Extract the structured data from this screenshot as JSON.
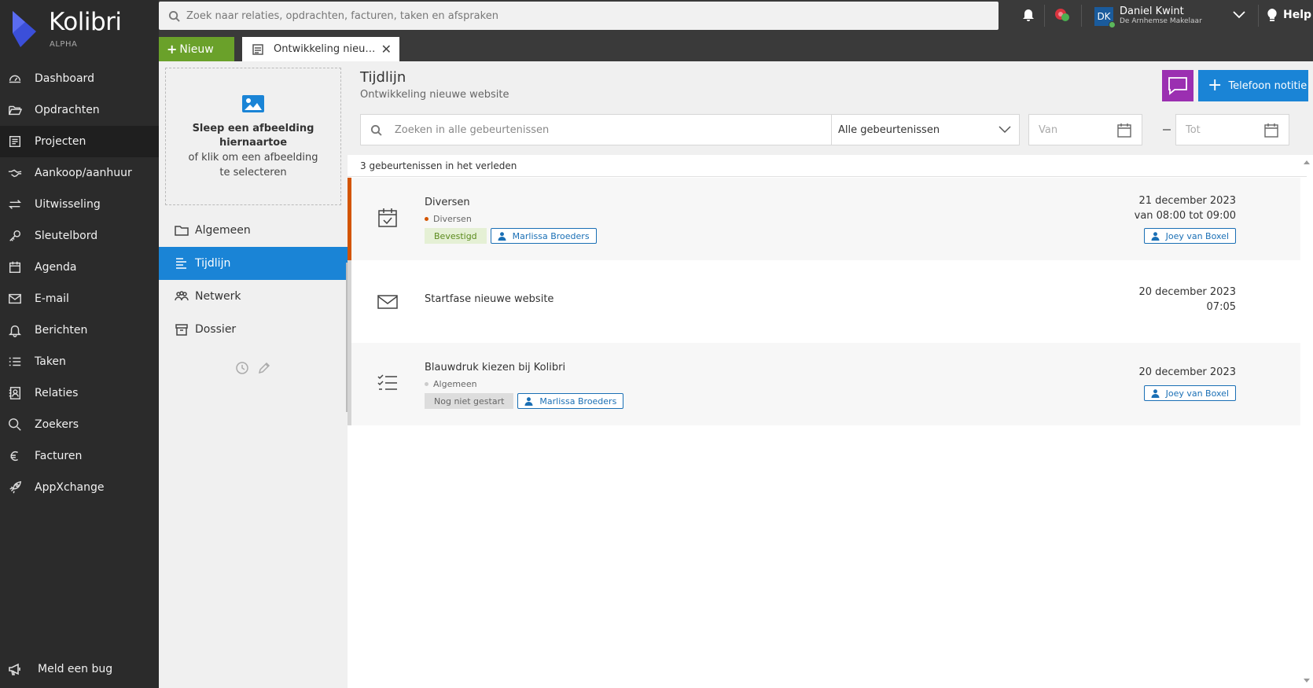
{
  "app": {
    "name": "Kolibri",
    "edition": "ALPHA"
  },
  "sidebar": {
    "items": [
      {
        "label": "Dashboard",
        "icon": "dashboard-icon"
      },
      {
        "label": "Opdrachten",
        "icon": "folder-open-icon"
      },
      {
        "label": "Projecten",
        "icon": "projects-icon"
      },
      {
        "label": "Aankoop/aanhuur",
        "icon": "handshake-icon"
      },
      {
        "label": "Uitwisseling",
        "icon": "exchange-icon"
      },
      {
        "label": "Sleutelbord",
        "icon": "key-icon"
      },
      {
        "label": "Agenda",
        "icon": "calendar-icon"
      },
      {
        "label": "E-mail",
        "icon": "envelope-icon"
      },
      {
        "label": "Berichten",
        "icon": "bell-icon"
      },
      {
        "label": "Taken",
        "icon": "tasks-icon"
      },
      {
        "label": "Relaties",
        "icon": "contacts-icon"
      },
      {
        "label": "Zoekers",
        "icon": "search-icon"
      },
      {
        "label": "Facturen",
        "icon": "euro-icon"
      },
      {
        "label": "AppXchange",
        "icon": "rocket-icon"
      }
    ],
    "active": "Projecten",
    "bug_label": "Meld een bug"
  },
  "topbar": {
    "search_placeholder": "Zoek naar relaties, opdrachten, facturen, taken en afspraken",
    "user": {
      "initials": "DK",
      "name": "Daniel Kwint",
      "company": "De Arnhemse Makelaar"
    },
    "help_label": "Help"
  },
  "tabs": {
    "new_label": "Nieuw",
    "open_tab": "Ontwikkeling nieu…"
  },
  "project": {
    "dropzone_title": "Sleep een afbeelding hiernaartoe",
    "dropzone_sub": "of klik om een afbeelding te selecteren",
    "nav": [
      "Algemeen",
      "Tijdlijn",
      "Netwerk",
      "Dossier"
    ],
    "active": "Tijdlijn"
  },
  "main": {
    "title": "Tijdlijn",
    "subtitle": "Ontwikkeling nieuwe website",
    "phone_note_label": "Telefoon notitie",
    "event_search_placeholder": "Zoeken in alle gebeurtenissen",
    "event_type": "Alle gebeurtenissen",
    "date_from_placeholder": "Van",
    "date_to_placeholder": "Tot",
    "count_text": "3 gebeurtenissen in het verleden"
  },
  "events": [
    {
      "title": "Diversen",
      "category": "Diversen",
      "category_color": "#d35400",
      "status": "Bevestigd",
      "assignee": "Marlissa Broeders",
      "date": "21 december 2023",
      "time": "van 08:00 tot 09:00",
      "owner": "Joey van Boxel",
      "icon": "calendar-check-icon"
    },
    {
      "title": "Startfase nieuwe website",
      "date": "20 december 2023",
      "time": "07:05",
      "icon": "envelope-icon"
    },
    {
      "title": "Blauwdruk kiezen bij Kolibri",
      "category": "Algemeen",
      "category_color": "#cccccc",
      "status": "Nog niet gestart",
      "assignee": "Marlissa Broeders",
      "date": "20 december 2023",
      "owner": "Joey van Boxel",
      "icon": "tasks-icon"
    }
  ]
}
